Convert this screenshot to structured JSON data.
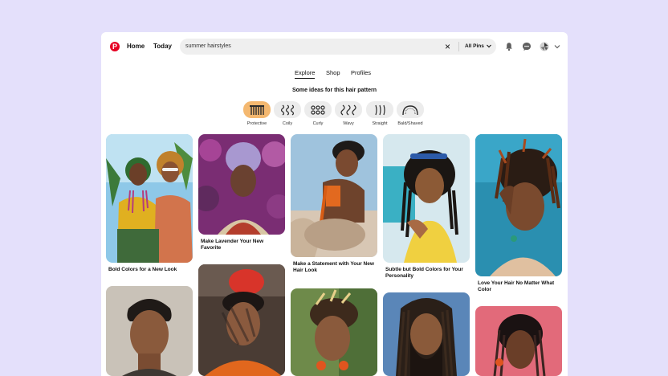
{
  "header": {
    "logo_letter": "P",
    "nav": {
      "home": "Home",
      "today": "Today"
    },
    "search": {
      "value": "summer hairstyles",
      "scope": "All Pins"
    },
    "icons": [
      "bell-icon",
      "chat-icon",
      "avatar",
      "chevron-down-icon"
    ]
  },
  "tabs": [
    {
      "label": "Explore",
      "active": true
    },
    {
      "label": "Shop",
      "active": false
    },
    {
      "label": "Profiles",
      "active": false
    }
  ],
  "hair_pattern": {
    "title": "Some ideas for this hair pattern",
    "chips": [
      {
        "label": "Protective",
        "active": true
      },
      {
        "label": "Coily",
        "active": false
      },
      {
        "label": "Curly",
        "active": false
      },
      {
        "label": "Wavy",
        "active": false
      },
      {
        "label": "Straight",
        "active": false
      },
      {
        "label": "Bald/Shaved",
        "active": false
      }
    ]
  },
  "pins": [
    {
      "title": "Bold Colors for a New Look"
    },
    {
      "title": ""
    },
    {
      "title": "Make Lavender Your New Favorite"
    },
    {
      "title": ""
    },
    {
      "title": "Make a Statement with Your New Hair Look"
    },
    {
      "title": ""
    },
    {
      "title": "Subtle but Bold Colors for Your Personality"
    },
    {
      "title": ""
    },
    {
      "title": "Love Your Hair No Matter What Color"
    },
    {
      "title": ""
    }
  ],
  "colors": {
    "brand": "#e60023",
    "active_chip": "#f4b870",
    "background": "#e4e0fb"
  }
}
